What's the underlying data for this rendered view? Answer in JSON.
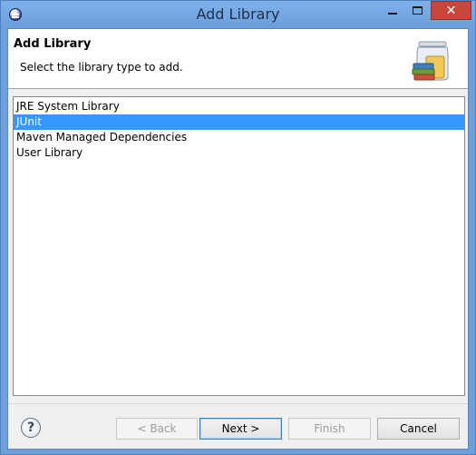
{
  "window": {
    "title": "Add Library",
    "close_label": "✕"
  },
  "header": {
    "title": "Add Library",
    "description": "Select the library type to add."
  },
  "library_types": {
    "items": [
      {
        "label": "JRE System Library",
        "selected": false
      },
      {
        "label": "JUnit",
        "selected": true
      },
      {
        "label": "Maven Managed Dependencies",
        "selected": false
      },
      {
        "label": "User Library",
        "selected": false
      }
    ]
  },
  "footer": {
    "help_label": "?",
    "back_label": "< Back",
    "next_label": "Next >",
    "finish_label": "Finish",
    "cancel_label": "Cancel"
  },
  "colors": {
    "selection": "#3399ff",
    "title_bar": "#6d9fdb",
    "close_button": "#c9463d"
  }
}
